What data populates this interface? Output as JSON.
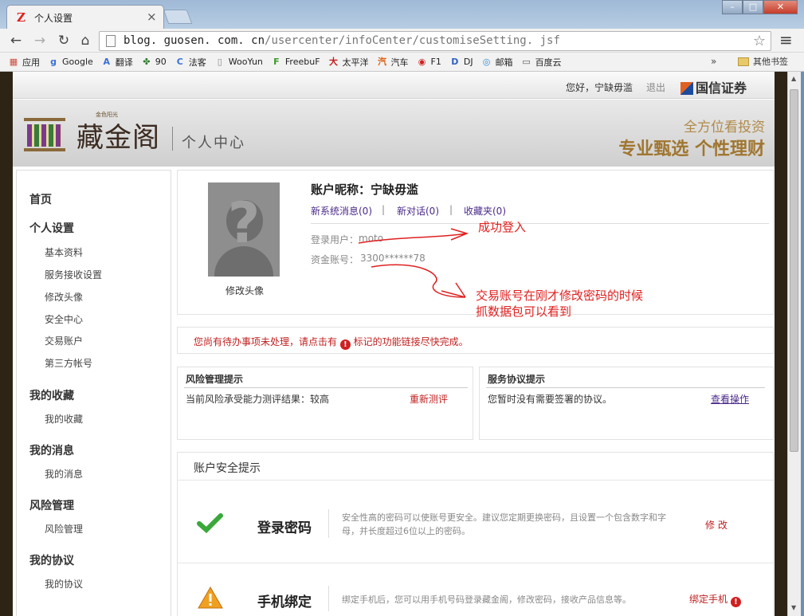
{
  "browser": {
    "tab_title": "个人设置",
    "tab_close": "×",
    "url_host": "blog. guosen. com. cn",
    "url_path": "/usercenter/infoCenter/customiseSetting. jsf",
    "star": "☆",
    "menu": "≡",
    "bookmarks": [
      {
        "label": "应用",
        "icon": "apps-icon",
        "glyph": "▦",
        "color": "#d04a3a"
      },
      {
        "label": "Google",
        "icon": "google-icon",
        "glyph": "g",
        "color": "#3b6fd8"
      },
      {
        "label": "翻译",
        "icon": "translate-icon",
        "glyph": "A",
        "color": "#3b6fd8"
      },
      {
        "label": "90",
        "icon": "bookmark-90-icon",
        "glyph": "✤",
        "color": "#2a7a2a"
      },
      {
        "label": "法客",
        "icon": "fake-icon",
        "glyph": "C",
        "color": "#3b6fd8"
      },
      {
        "label": "WooYun",
        "icon": "page-icon",
        "glyph": "▯",
        "color": "#888"
      },
      {
        "label": "FreebuF",
        "icon": "freebuf-icon",
        "glyph": "F",
        "color": "#3a9a2a"
      },
      {
        "label": "太平洋",
        "icon": "pconline-icon",
        "glyph": "大",
        "color": "#c02020"
      },
      {
        "label": "汽车",
        "icon": "car-icon",
        "glyph": "汽",
        "color": "#e06010"
      },
      {
        "label": "F1",
        "icon": "weibo-icon",
        "glyph": "◉",
        "color": "#d02020"
      },
      {
        "label": "DJ",
        "icon": "dj-icon",
        "glyph": "D",
        "color": "#3060c0"
      },
      {
        "label": "邮箱",
        "icon": "mail-icon",
        "glyph": "◎",
        "color": "#2a8ad0"
      },
      {
        "label": "百度云",
        "icon": "baidu-icon",
        "glyph": "▭",
        "color": "#555"
      }
    ],
    "more": "»",
    "other_bookmarks": "其他书签"
  },
  "header": {
    "greeting": "您好，宁缺毋滥",
    "logout": "退出",
    "broker": "国信证券",
    "brand_small": "金色阳光",
    "brand": "藏金阁",
    "section": "个人中心",
    "slogan1": "全方位看投资",
    "slogan2": "专业甄选 个性理财"
  },
  "sidebar": {
    "home": "首页",
    "groups": [
      {
        "title": "个人设置",
        "items": [
          "基本资料",
          "服务接收设置",
          "修改头像",
          "安全中心",
          "交易账户",
          "第三方帐号"
        ]
      },
      {
        "title": "我的收藏",
        "items": [
          "我的收藏"
        ]
      },
      {
        "title": "我的消息",
        "items": [
          "我的消息"
        ]
      },
      {
        "title": "风险管理",
        "items": [
          "风险管理"
        ]
      },
      {
        "title": "我的协议",
        "items": [
          "我的协议"
        ]
      }
    ]
  },
  "profile": {
    "nickname": "账户昵称：宁缺毋滥",
    "sys_msg": "新系统消息(0)",
    "new_chat": "新对话(0)",
    "favorites": "收藏夹(0)",
    "divider": "|",
    "login_label": "登录用户：",
    "login_value": "moto",
    "account_label": "资金账号：",
    "account_value": "3300******78",
    "change_avatar": "修改头像"
  },
  "annotations": {
    "login_ok": "成功登入",
    "account_note_1": "交易账号在刚才修改密码的时候",
    "account_note_2": "抓数据包可以看到"
  },
  "todo": {
    "before": "您尚有待办事项未处理，请点击有",
    "after": "标记的功能链接尽快完成。",
    "mark": "!"
  },
  "risk": {
    "title": "风险管理提示",
    "text": "当前风险承受能力测评结果：较高",
    "action": "重新测评"
  },
  "service": {
    "title": "服务协议提示",
    "text": "您暂时没有需要签署的协议。",
    "action": "查看操作"
  },
  "security": {
    "title": "账户安全提示",
    "rows": [
      {
        "name": "登录密码",
        "desc": "安全性高的密码可以使账号更安全。建议您定期更换密码，且设置一个包含数字和字母，并长度超过6位以上的密码。",
        "action": "修 改"
      },
      {
        "name": "手机绑定",
        "desc": "绑定手机后，您可以用手机号码登录藏金阁，修改密码，接收产品信息等。",
        "action": "绑定手机"
      }
    ]
  },
  "colors": {
    "accent": "#b08a4a",
    "link": "#4a2a8a",
    "alert": "#c02020",
    "annotation": "#e02020"
  }
}
